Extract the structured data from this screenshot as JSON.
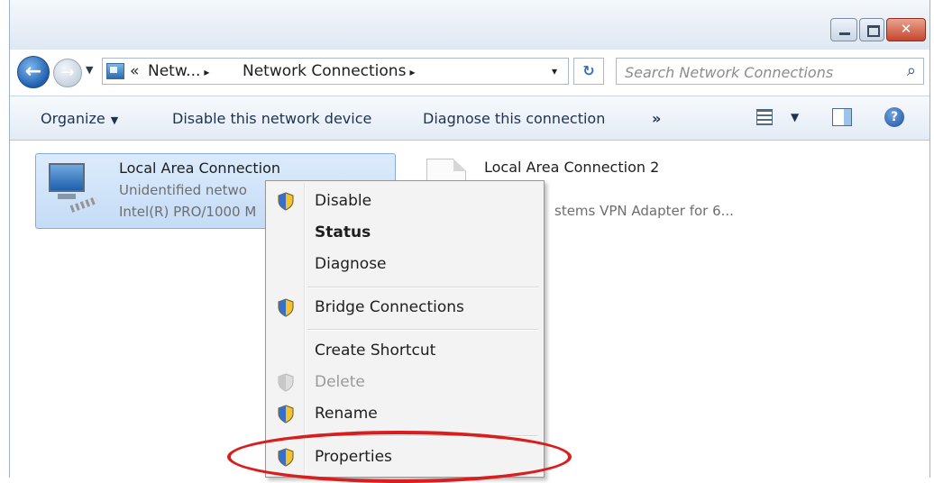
{
  "address": {
    "overflow": "«",
    "crumb1": "Netw...",
    "crumb2": "Network Connections",
    "separator": "▸",
    "dropdown": "▾"
  },
  "search": {
    "placeholder": "Search Network Connections"
  },
  "toolbar": {
    "organize": "Organize",
    "disable": "Disable this network device",
    "diagnose": "Diagnose this connection",
    "more": "»",
    "help": "?"
  },
  "connections": [
    {
      "name": "Local Area Connection",
      "status": "Unidentified netwo",
      "device": "Intel(R) PRO/1000 M"
    },
    {
      "name": "Local Area Connection 2",
      "status": "",
      "device": "stems VPN Adapter for 6..."
    }
  ],
  "context_menu": {
    "items": [
      {
        "label": "Disable",
        "shield": true,
        "bold": false,
        "disabled": false
      },
      {
        "label": "Status",
        "shield": false,
        "bold": true,
        "disabled": false
      },
      {
        "label": "Diagnose",
        "shield": false,
        "bold": false,
        "disabled": false
      },
      {
        "label": "Bridge Connections",
        "shield": true,
        "bold": false,
        "disabled": false
      },
      {
        "label": "Create Shortcut",
        "shield": false,
        "bold": false,
        "disabled": false
      },
      {
        "label": "Delete",
        "shield": true,
        "bold": false,
        "disabled": true
      },
      {
        "label": "Rename",
        "shield": true,
        "bold": false,
        "disabled": false
      },
      {
        "label": "Properties",
        "shield": true,
        "bold": false,
        "disabled": false
      }
    ]
  },
  "colors": {
    "highlight_ellipse": "#d81e1e",
    "selection": "#c4dcf6",
    "accent": "#1f5fae"
  }
}
